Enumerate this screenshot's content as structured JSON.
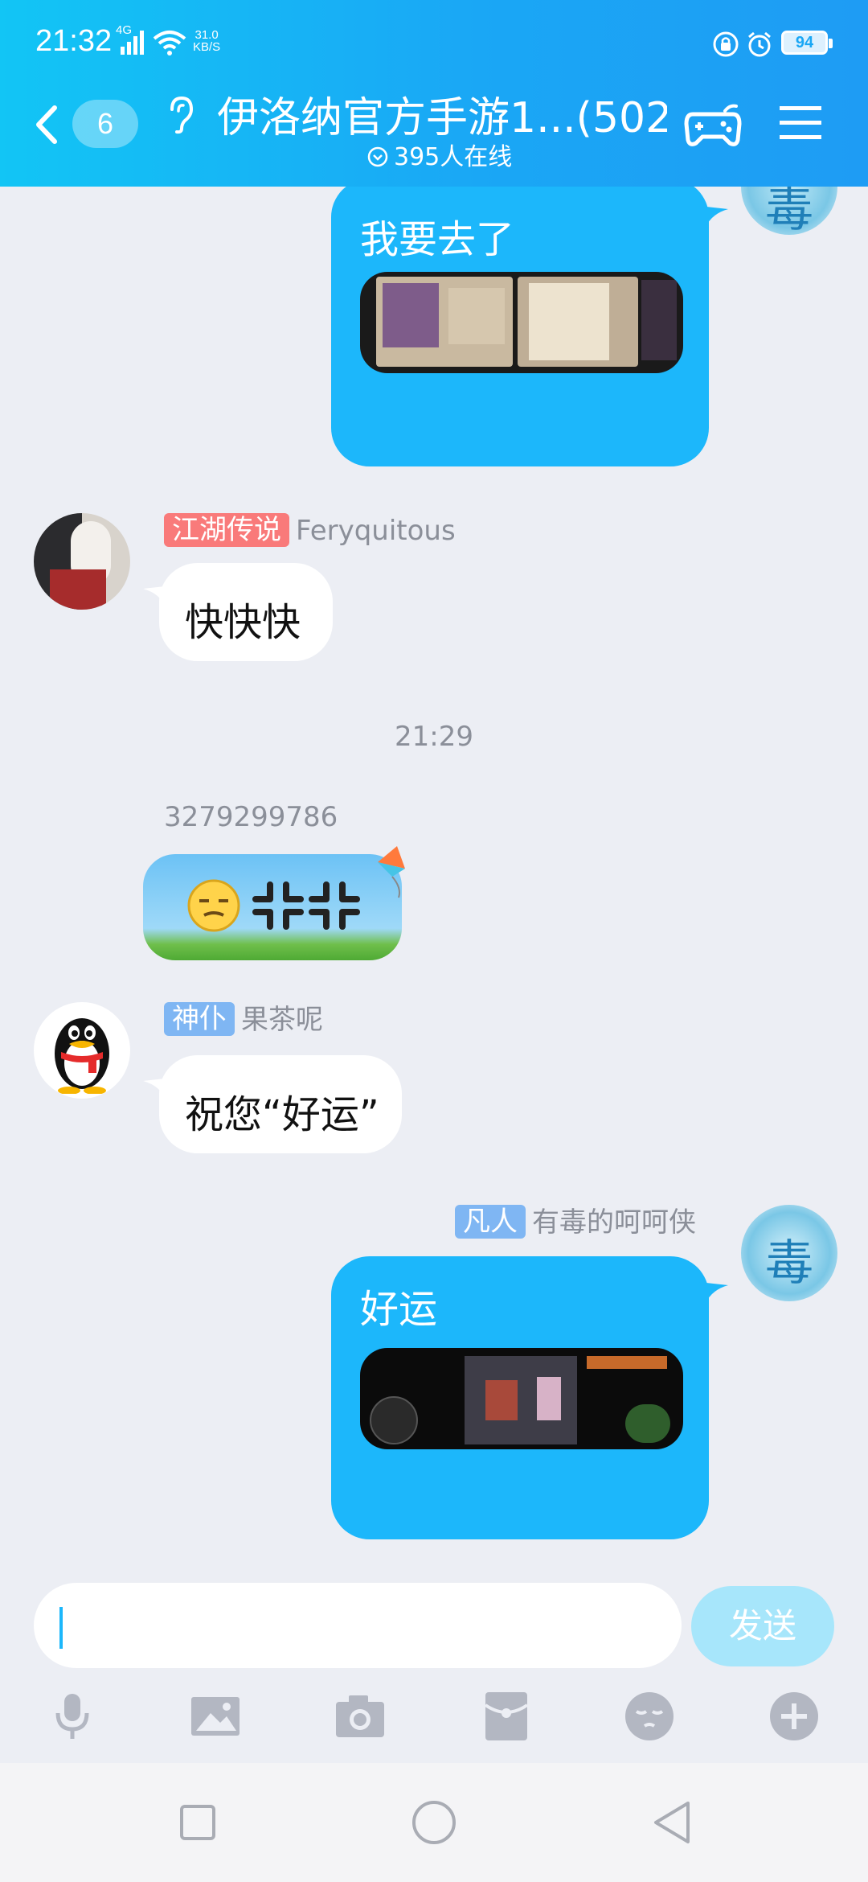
{
  "status_bar": {
    "time": "21:32",
    "network": "4G",
    "speed_value": "31.0",
    "speed_unit": "KB/S",
    "battery": "94"
  },
  "header": {
    "back_count": "6",
    "title": "伊洛纳官方手游1...(502)",
    "online_text": "395人在线"
  },
  "messages": [
    {
      "side": "right",
      "text": "我要去了",
      "has_image": true
    },
    {
      "side": "left",
      "title_tag": "江湖传说",
      "sender": "Feryquitous",
      "text": "快快快"
    },
    {
      "type": "time",
      "text": "21:29"
    },
    {
      "side": "left",
      "sender": "3279299786",
      "sticker": true
    },
    {
      "side": "left",
      "title_tag": "神仆",
      "sender": "果茶呢",
      "text": "祝您“好运”"
    },
    {
      "side": "right",
      "title_tag": "凡人",
      "sender": "有毒的呵呵侠",
      "text": "好运",
      "has_image": true
    }
  ],
  "input": {
    "value": "",
    "send_label": "发送"
  },
  "toolbar": [
    "mic-icon",
    "image-icon",
    "camera-icon",
    "red-packet-icon",
    "emoji-icon",
    "plus-icon"
  ],
  "colors": {
    "header_start": "#12c5f5",
    "header_end": "#1e9cf4",
    "bubble_blue": "#1cb7fb",
    "tag_red": "#f97a7a",
    "tag_blue": "#7fb6f3",
    "chat_bg": "#eceef4"
  }
}
